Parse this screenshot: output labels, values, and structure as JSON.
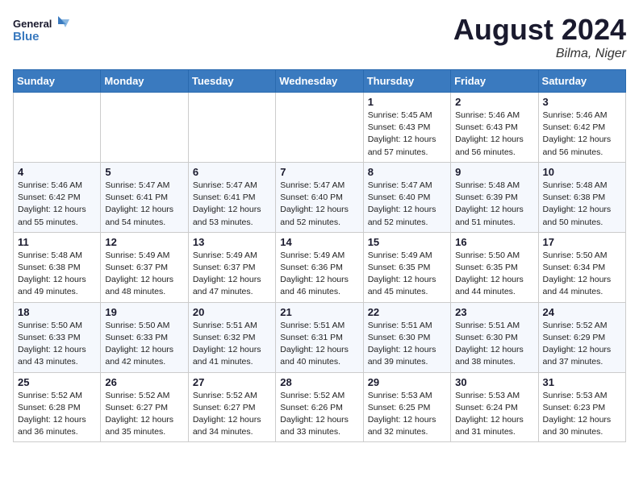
{
  "header": {
    "logo_line1": "General",
    "logo_line2": "Blue",
    "month_title": "August 2024",
    "location": "Bilma, Niger"
  },
  "days_of_week": [
    "Sunday",
    "Monday",
    "Tuesday",
    "Wednesday",
    "Thursday",
    "Friday",
    "Saturday"
  ],
  "weeks": [
    [
      {
        "day": "",
        "info": ""
      },
      {
        "day": "",
        "info": ""
      },
      {
        "day": "",
        "info": ""
      },
      {
        "day": "",
        "info": ""
      },
      {
        "day": "1",
        "info": "Sunrise: 5:45 AM\nSunset: 6:43 PM\nDaylight: 12 hours\nand 57 minutes."
      },
      {
        "day": "2",
        "info": "Sunrise: 5:46 AM\nSunset: 6:43 PM\nDaylight: 12 hours\nand 56 minutes."
      },
      {
        "day": "3",
        "info": "Sunrise: 5:46 AM\nSunset: 6:42 PM\nDaylight: 12 hours\nand 56 minutes."
      }
    ],
    [
      {
        "day": "4",
        "info": "Sunrise: 5:46 AM\nSunset: 6:42 PM\nDaylight: 12 hours\nand 55 minutes."
      },
      {
        "day": "5",
        "info": "Sunrise: 5:47 AM\nSunset: 6:41 PM\nDaylight: 12 hours\nand 54 minutes."
      },
      {
        "day": "6",
        "info": "Sunrise: 5:47 AM\nSunset: 6:41 PM\nDaylight: 12 hours\nand 53 minutes."
      },
      {
        "day": "7",
        "info": "Sunrise: 5:47 AM\nSunset: 6:40 PM\nDaylight: 12 hours\nand 52 minutes."
      },
      {
        "day": "8",
        "info": "Sunrise: 5:47 AM\nSunset: 6:40 PM\nDaylight: 12 hours\nand 52 minutes."
      },
      {
        "day": "9",
        "info": "Sunrise: 5:48 AM\nSunset: 6:39 PM\nDaylight: 12 hours\nand 51 minutes."
      },
      {
        "day": "10",
        "info": "Sunrise: 5:48 AM\nSunset: 6:38 PM\nDaylight: 12 hours\nand 50 minutes."
      }
    ],
    [
      {
        "day": "11",
        "info": "Sunrise: 5:48 AM\nSunset: 6:38 PM\nDaylight: 12 hours\nand 49 minutes."
      },
      {
        "day": "12",
        "info": "Sunrise: 5:49 AM\nSunset: 6:37 PM\nDaylight: 12 hours\nand 48 minutes."
      },
      {
        "day": "13",
        "info": "Sunrise: 5:49 AM\nSunset: 6:37 PM\nDaylight: 12 hours\nand 47 minutes."
      },
      {
        "day": "14",
        "info": "Sunrise: 5:49 AM\nSunset: 6:36 PM\nDaylight: 12 hours\nand 46 minutes."
      },
      {
        "day": "15",
        "info": "Sunrise: 5:49 AM\nSunset: 6:35 PM\nDaylight: 12 hours\nand 45 minutes."
      },
      {
        "day": "16",
        "info": "Sunrise: 5:50 AM\nSunset: 6:35 PM\nDaylight: 12 hours\nand 44 minutes."
      },
      {
        "day": "17",
        "info": "Sunrise: 5:50 AM\nSunset: 6:34 PM\nDaylight: 12 hours\nand 44 minutes."
      }
    ],
    [
      {
        "day": "18",
        "info": "Sunrise: 5:50 AM\nSunset: 6:33 PM\nDaylight: 12 hours\nand 43 minutes."
      },
      {
        "day": "19",
        "info": "Sunrise: 5:50 AM\nSunset: 6:33 PM\nDaylight: 12 hours\nand 42 minutes."
      },
      {
        "day": "20",
        "info": "Sunrise: 5:51 AM\nSunset: 6:32 PM\nDaylight: 12 hours\nand 41 minutes."
      },
      {
        "day": "21",
        "info": "Sunrise: 5:51 AM\nSunset: 6:31 PM\nDaylight: 12 hours\nand 40 minutes."
      },
      {
        "day": "22",
        "info": "Sunrise: 5:51 AM\nSunset: 6:30 PM\nDaylight: 12 hours\nand 39 minutes."
      },
      {
        "day": "23",
        "info": "Sunrise: 5:51 AM\nSunset: 6:30 PM\nDaylight: 12 hours\nand 38 minutes."
      },
      {
        "day": "24",
        "info": "Sunrise: 5:52 AM\nSunset: 6:29 PM\nDaylight: 12 hours\nand 37 minutes."
      }
    ],
    [
      {
        "day": "25",
        "info": "Sunrise: 5:52 AM\nSunset: 6:28 PM\nDaylight: 12 hours\nand 36 minutes."
      },
      {
        "day": "26",
        "info": "Sunrise: 5:52 AM\nSunset: 6:27 PM\nDaylight: 12 hours\nand 35 minutes."
      },
      {
        "day": "27",
        "info": "Sunrise: 5:52 AM\nSunset: 6:27 PM\nDaylight: 12 hours\nand 34 minutes."
      },
      {
        "day": "28",
        "info": "Sunrise: 5:52 AM\nSunset: 6:26 PM\nDaylight: 12 hours\nand 33 minutes."
      },
      {
        "day": "29",
        "info": "Sunrise: 5:53 AM\nSunset: 6:25 PM\nDaylight: 12 hours\nand 32 minutes."
      },
      {
        "day": "30",
        "info": "Sunrise: 5:53 AM\nSunset: 6:24 PM\nDaylight: 12 hours\nand 31 minutes."
      },
      {
        "day": "31",
        "info": "Sunrise: 5:53 AM\nSunset: 6:23 PM\nDaylight: 12 hours\nand 30 minutes."
      }
    ]
  ]
}
